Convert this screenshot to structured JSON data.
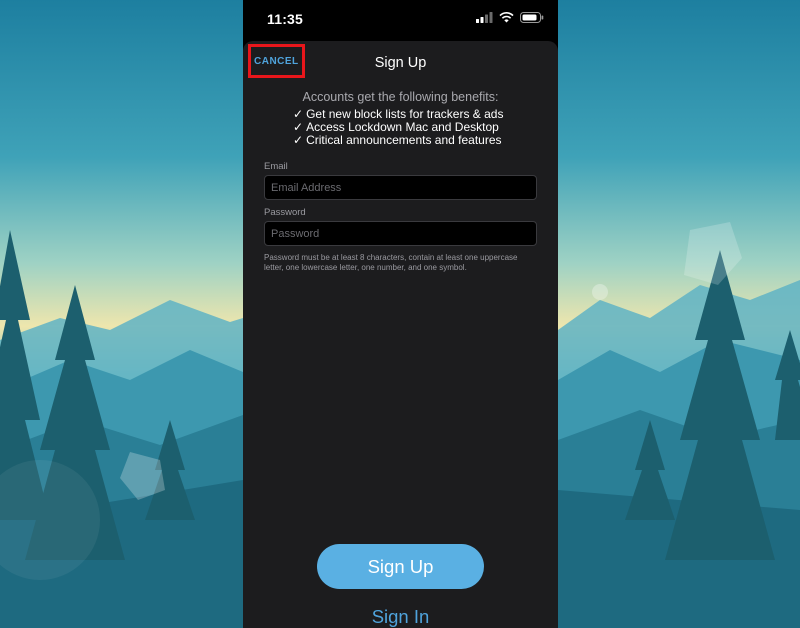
{
  "status_bar": {
    "time": "11:35",
    "icons": [
      "signal-icon",
      "wifi-icon",
      "battery-icon"
    ]
  },
  "nav": {
    "cancel_label": "CANCEL",
    "title": "Sign Up"
  },
  "benefits": {
    "heading": "Accounts get the following benefits:",
    "check_glyph": "✓",
    "items": [
      "Get new block lists for trackers & ads",
      "Access Lockdown Mac and Desktop",
      "Critical announcements and features"
    ]
  },
  "form": {
    "email_label": "Email",
    "email_placeholder": "Email Address",
    "email_value": "",
    "password_label": "Password",
    "password_placeholder": "Password",
    "password_value": "",
    "password_hint": "Password must be at least 8 characters, contain at least one uppercase letter, one lowercase letter, one number, and one symbol."
  },
  "actions": {
    "signup_label": "Sign Up",
    "signin_label": "Sign In"
  },
  "colors": {
    "accent": "#4fa3dc",
    "button": "#5ab0e3",
    "highlight": "#e8161b",
    "sheet_background": "#1c1c1e"
  }
}
